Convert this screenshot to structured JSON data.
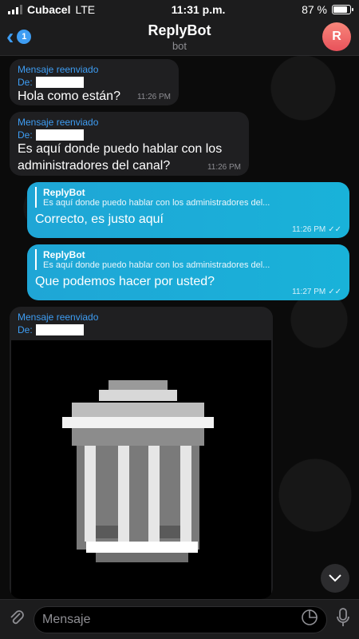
{
  "status_bar": {
    "carrier": "Cubacel",
    "network": "LTE",
    "time": "11:31 p.m.",
    "battery": "87 %",
    "battery_level": 0.87
  },
  "header": {
    "back_count": "1",
    "title": "ReplyBot",
    "subtitle": "bot",
    "avatar_letter": "R",
    "accent": "#3e9df3"
  },
  "messages": [
    {
      "forwarded_label": "Mensaje reenviado",
      "from_label": "De:",
      "text": "Hola como están?",
      "time": "11:26 PM"
    },
    {
      "forwarded_label": "Mensaje reenviado",
      "from_label": "De:",
      "text_line1": "Es aquí donde puedo hablar con los",
      "text_line2": "administradores del canal?",
      "time": "11:26 PM"
    },
    {
      "reply_name": "ReplyBot",
      "reply_text": "Es aquí donde puedo hablar con los administradores del...",
      "text": "Correcto, es justo aquí",
      "time": "11:26 PM"
    },
    {
      "reply_name": "ReplyBot",
      "reply_text": "Es aquí donde puedo hablar con los administradores del...",
      "text": "Que podemos hacer por usted?",
      "time": "11:27 PM"
    },
    {
      "forwarded_label": "Mensaje reenviado",
      "from_label": "De:"
    }
  ],
  "input": {
    "placeholder": "Mensaje"
  },
  "icons": {
    "attach": "paperclip-icon",
    "sticker": "sticker-icon",
    "mic": "microphone-icon",
    "scroll": "chevron-down-icon",
    "trash": "trash-can-icon"
  }
}
